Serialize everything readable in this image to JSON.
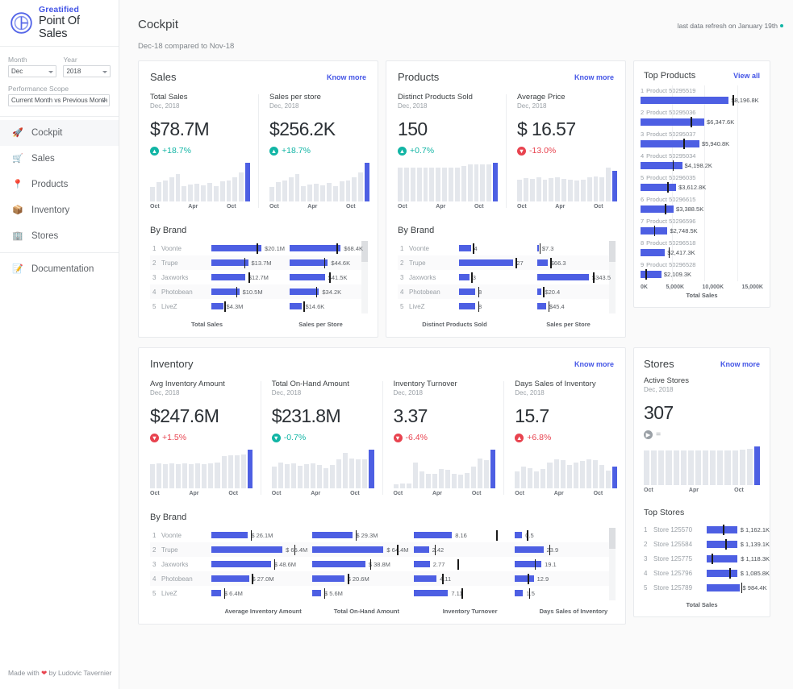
{
  "brand": {
    "top": "Greatified",
    "bottom": "Point Of Sales"
  },
  "filters": {
    "month_label": "Month",
    "month_value": "Dec",
    "year_label": "Year",
    "year_value": "2018",
    "scope_label": "Performance Scope",
    "scope_value": "Current Month vs Previous Month"
  },
  "nav": [
    {
      "label": "Cockpit",
      "icon": "rocket-icon",
      "glyph": "🚀"
    },
    {
      "label": "Sales",
      "icon": "cart-icon",
      "glyph": "🛒"
    },
    {
      "label": "Products",
      "icon": "pin-icon",
      "glyph": "📍"
    },
    {
      "label": "Inventory",
      "icon": "box-icon",
      "glyph": "📦"
    },
    {
      "label": "Stores",
      "icon": "building-icon",
      "glyph": "🏢"
    },
    {
      "label": "Documentation",
      "icon": "memo-icon",
      "glyph": "📝"
    }
  ],
  "footer": {
    "prefix": "Made with",
    "heart": "❤",
    "suffix": "by Ludovic Tavernier"
  },
  "header": {
    "title": "Cockpit",
    "refresh": "last data refresh on January 19th",
    "subtitle": "Dec-18 compared to Nov-18"
  },
  "labels": {
    "know_more": "Know more",
    "view_all": "View all",
    "by_brand": "By Brand",
    "top_products": "Top Products",
    "top_stores": "Top Stores"
  },
  "sales": {
    "title": "Sales",
    "kpis": [
      {
        "name": "Total Sales",
        "period": "Dec, 2018",
        "value": "$78.7M",
        "delta": "+18.7%",
        "dir": "up",
        "tone": "teal"
      },
      {
        "name": "Sales per store",
        "period": "Dec, 2018",
        "value": "$256.2K",
        "delta": "+18.7%",
        "dir": "up",
        "tone": "teal"
      }
    ],
    "axis": [
      "Oct",
      "Apr",
      "Oct"
    ],
    "footers": [
      "Total Sales",
      "Sales per Store"
    ],
    "brands": [
      {
        "rank": "1",
        "name": "Voonte",
        "v1": "$20.1M",
        "b1": 72,
        "t1": 62,
        "v2": "$68.4K",
        "b2": 74,
        "t2": 64
      },
      {
        "rank": "2",
        "name": "Trupe",
        "v1": "$13.7M",
        "b1": 50,
        "t1": 45,
        "v2": "$44.6K",
        "b2": 52,
        "t2": 47
      },
      {
        "rank": "3",
        "name": "Jaxworks",
        "v1": "$12.7M",
        "b1": 46,
        "t1": 51,
        "v2": "$41.5K",
        "b2": 48,
        "t2": 54
      },
      {
        "rank": "4",
        "name": "Photobean",
        "v1": "$10.5M",
        "b1": 38,
        "t1": 34,
        "v2": "$34.2K",
        "b2": 40,
        "t2": 36
      },
      {
        "rank": "5",
        "name": "LiveZ",
        "v1": "$4.3M",
        "b1": 16,
        "t1": 18,
        "v2": "$14.6K",
        "b2": 17,
        "t2": 19
      }
    ]
  },
  "products": {
    "title": "Products",
    "kpis": [
      {
        "name": "Distinct Products Sold",
        "period": "Dec, 2018",
        "value": "150",
        "delta": "+0.7%",
        "dir": "up",
        "tone": "teal"
      },
      {
        "name": "Average Price",
        "period": "Dec, 2018",
        "value": "$ 16.57",
        "delta": "-13.0%",
        "dir": "down",
        "tone": "red"
      }
    ],
    "axis": [
      "Oct",
      "Apr",
      "Oct"
    ],
    "footers": [
      "Distinct Products Sold",
      "Sales per Store"
    ],
    "brands": [
      {
        "rank": "1",
        "name": "Voonte",
        "v1": "4",
        "b1": 16,
        "t1": 19,
        "v2": "$7.3",
        "b2": 2,
        "t2": 3
      },
      {
        "rank": "2",
        "name": "Trupe",
        "v1": "27",
        "b1": 74,
        "t1": 77,
        "v2": "$66.3",
        "b2": 14,
        "t2": 18
      },
      {
        "rank": "3",
        "name": "Jaxworks",
        "v1": "3",
        "b1": 14,
        "t1": 17,
        "v2": "$343.5",
        "b2": 72,
        "t2": 76
      },
      {
        "rank": "4",
        "name": "Photobean",
        "v1": "8",
        "b1": 22,
        "t1": 26,
        "v2": "$20.4",
        "b2": 6,
        "t2": 8
      },
      {
        "rank": "5",
        "name": "LiveZ",
        "v1": "8",
        "b1": 22,
        "t1": 26,
        "v2": "$45.4",
        "b2": 12,
        "t2": 15
      }
    ]
  },
  "top_products": {
    "axis": [
      "0K",
      "5,000K",
      "10,000K",
      "15,000K"
    ],
    "axis_label": "Total Sales",
    "items": [
      {
        "rank": "1",
        "name": "Product 50295519",
        "value": "$8,196.8K",
        "bar": 72,
        "tick": 75
      },
      {
        "rank": "2",
        "name": "Product 50295036",
        "value": "$6,347.6K",
        "bar": 52,
        "tick": 41
      },
      {
        "rank": "3",
        "name": "Product 50295037",
        "value": "$5,940.8K",
        "bar": 48,
        "tick": 35
      },
      {
        "rank": "4",
        "name": "Product 50295034",
        "value": "$4,198.2K",
        "bar": 34,
        "tick": 26
      },
      {
        "rank": "5",
        "name": "Product 50296035",
        "value": "$3,612.8K",
        "bar": 29,
        "tick": 22
      },
      {
        "rank": "6",
        "name": "Product 50296615",
        "value": "$3,388.5K",
        "bar": 27,
        "tick": 20
      },
      {
        "rank": "7",
        "name": "Product 50296596",
        "value": "$2,748.5K",
        "bar": 22,
        "tick": 11
      },
      {
        "rank": "8",
        "name": "Product 50296518",
        "value": "$2,417.3K",
        "bar": 20,
        "tick": 23
      },
      {
        "rank": "9",
        "name": "Product 50296528",
        "value": "$2,109.3K",
        "bar": 17,
        "tick": 4
      }
    ]
  },
  "inventory": {
    "title": "Inventory",
    "kpis": [
      {
        "name": "Avg Inventory Amount",
        "period": "Dec, 2018",
        "value": "$247.6M",
        "delta": "+1.5%",
        "dir": "down",
        "tone": "red"
      },
      {
        "name": "Total On-Hand Amount",
        "period": "Dec, 2018",
        "value": "$231.8M",
        "delta": "-0.7%",
        "dir": "down",
        "tone": "teal"
      },
      {
        "name": "Inventory Turnover",
        "period": "Dec, 2018",
        "value": "3.37",
        "delta": "-6.4%",
        "dir": "down",
        "tone": "red"
      },
      {
        "name": "Days Sales of Inventory",
        "period": "Dec, 2018",
        "value": "15.7",
        "delta": "+6.8%",
        "dir": "up",
        "tone": "red"
      }
    ],
    "axis": [
      "Oct",
      "Apr",
      "Oct"
    ],
    "footers": [
      "Average Inventory Amount",
      "Total On-Hand Amount",
      "Inventory Turnover",
      "Days Sales of Inventory"
    ],
    "brands": [
      {
        "rank": "1",
        "name": "Voonte",
        "v1": "$ 26.1M",
        "b1": 38,
        "t1": 41,
        "v2": "$ 29.3M",
        "b2": 42,
        "t2": 45,
        "v3": "8.16",
        "b3": 40,
        "t3": 86,
        "v4": "0.5",
        "b4": 8,
        "t4": 13
      },
      {
        "rank": "2",
        "name": "Trupe",
        "v1": "$ 65.4M",
        "b1": 82,
        "t1": 86,
        "v2": "$ 64.4M",
        "b2": 84,
        "t2": 88,
        "v3": "2.42",
        "b3": 16,
        "t3": 22,
        "v4": "23.9",
        "b4": 30,
        "t4": 36
      },
      {
        "rank": "3",
        "name": "Jaxworks",
        "v1": "$ 48.6M",
        "b1": 62,
        "t1": 65,
        "v2": "$ 38.8M",
        "b2": 55,
        "t2": 60,
        "v3": "2.77",
        "b3": 17,
        "t3": 46,
        "v4": "19.1",
        "b4": 28,
        "t4": 21
      },
      {
        "rank": "4",
        "name": "Photobean",
        "v1": "$ 27.0M",
        "b1": 39,
        "t1": 42,
        "v2": "$ 20.6M",
        "b2": 33,
        "t2": 37,
        "v3": "4.11",
        "b3": 24,
        "t3": 30,
        "v4": "12.9",
        "b4": 20,
        "t4": 14
      },
      {
        "rank": "5",
        "name": "LiveZ",
        "v1": "$ 6.4M",
        "b1": 10,
        "t1": 13,
        "v2": "$ 5.6M",
        "b2": 9,
        "t2": 12,
        "v3": "7.11",
        "b3": 36,
        "t3": 50,
        "v4": "1.5",
        "b4": 9,
        "t4": 15
      }
    ]
  },
  "stores": {
    "title": "Stores",
    "kpi": {
      "name": "Active Stores",
      "period": "Dec, 2018",
      "value": "307",
      "delta": "=",
      "dir": "flat",
      "tone": "gray"
    },
    "axis": [
      "Oct",
      "Apr",
      "Oct"
    ],
    "axis_label": "Total Sales",
    "top": [
      {
        "rank": "1",
        "name": "Store 125570",
        "value": "$ 1,162.1K",
        "bar": 62,
        "tick": 26
      },
      {
        "rank": "2",
        "name": "Store 125584",
        "value": "$ 1,139.1K",
        "bar": 61,
        "tick": 30
      },
      {
        "rank": "3",
        "name": "Store 125775",
        "value": "$ 1,118.3K",
        "bar": 60,
        "tick": 8
      },
      {
        "rank": "4",
        "name": "Store 125796",
        "value": "$ 1,085.8K",
        "bar": 58,
        "tick": 36
      },
      {
        "rank": "5",
        "name": "Store 125789",
        "value": "$ 984.4K",
        "bar": 52,
        "tick": 55
      }
    ]
  },
  "sparklines": {
    "total_sales": [
      38,
      50,
      55,
      62,
      70,
      40,
      43,
      45,
      42,
      48,
      40,
      52,
      55,
      62,
      75,
      100
    ],
    "sales_per_store": [
      38,
      50,
      55,
      62,
      70,
      40,
      43,
      45,
      42,
      48,
      40,
      52,
      55,
      62,
      75,
      100
    ],
    "distinct": [
      88,
      88,
      88,
      88,
      88,
      88,
      88,
      88,
      88,
      88,
      92,
      95,
      95,
      95,
      96,
      100
    ],
    "avg_price": [
      56,
      60,
      58,
      62,
      56,
      60,
      62,
      58,
      56,
      54,
      56,
      62,
      64,
      62,
      88,
      80
    ],
    "avg_inventory": [
      62,
      64,
      62,
      64,
      62,
      64,
      62,
      64,
      62,
      64,
      66,
      84,
      86,
      86,
      88,
      100
    ],
    "onhand": [
      56,
      66,
      62,
      64,
      58,
      62,
      64,
      60,
      52,
      60,
      74,
      92,
      78,
      76,
      76,
      100
    ],
    "turnover": [
      10,
      12,
      12,
      66,
      44,
      38,
      38,
      50,
      48,
      38,
      36,
      40,
      56,
      78,
      72,
      100
    ],
    "days_sales": [
      44,
      56,
      52,
      44,
      50,
      66,
      74,
      72,
      60,
      66,
      70,
      76,
      72,
      60,
      46,
      56
    ],
    "active_stores": [
      90,
      90,
      90,
      90,
      90,
      90,
      90,
      90,
      90,
      90,
      90,
      90,
      90,
      92,
      94,
      100
    ]
  }
}
